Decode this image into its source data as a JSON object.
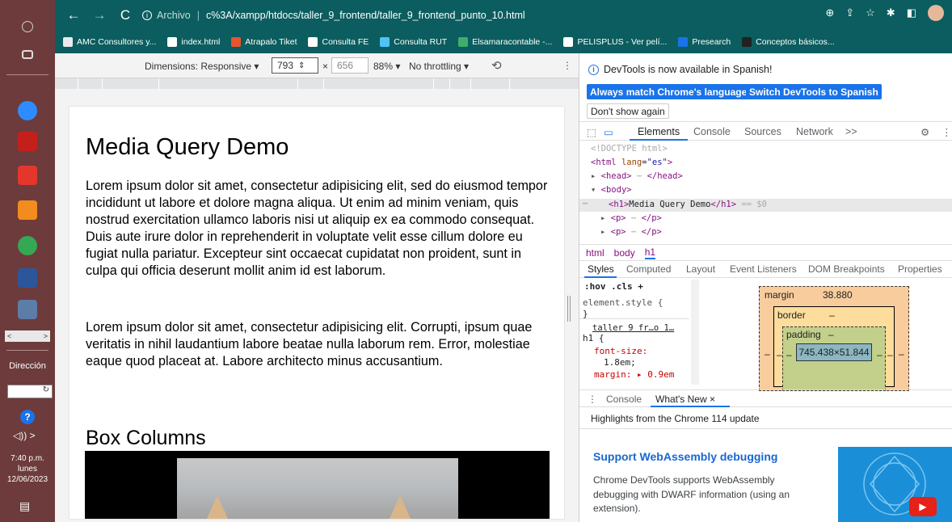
{
  "browser": {
    "url_prefix": "Archivo",
    "url_path": "c%3A/xampp/htdocs/taller_9_frontend/taller_9_frontend_punto_10.html",
    "bookmarks": [
      {
        "label": "AMC Consultores y...",
        "color": "#e8eaed"
      },
      {
        "label": "index.html",
        "color": "#ffffff"
      },
      {
        "label": "Atrapalo Tiket",
        "color": "#e8542e"
      },
      {
        "label": "Consulta FE",
        "color": "#ffffff"
      },
      {
        "label": "Consulta RUT",
        "color": "#4fc3f7"
      },
      {
        "label": "Elsamaracontable -...",
        "color": "#3fae6a"
      },
      {
        "label": "PELISPLUS - Ver pelí...",
        "color": "#ffffff"
      },
      {
        "label": "Presearch",
        "color": "#1a73e8"
      },
      {
        "label": "Conceptos básicos...",
        "color": "#222222"
      }
    ]
  },
  "taskbar": {
    "direccion_label": "Dirección",
    "time": "7:40 p.m.",
    "day": "lunes",
    "date": "12/06/2023",
    "scroll_left": "<",
    "scroll_right": ">",
    "dir_refresh": "↻",
    "vol": "◁)) >"
  },
  "device_toolbar": {
    "dimensions_label": "Dimensions: Responsive ▾",
    "width": "793",
    "x": "×",
    "height": "656",
    "zoom": "88% ▾",
    "throttle": "No throttling ▾"
  },
  "page": {
    "h1": "Media Query Demo",
    "p1": "Lorem ipsum dolor sit amet, consectetur adipisicing elit, sed do eiusmod tempor incididunt ut labore et dolore magna aliqua. Ut enim ad minim veniam, quis nostrud exercitation ullamco laboris nisi ut aliquip ex ea commodo consequat. Duis aute irure dolor in reprehenderit in voluptate velit esse cillum dolore eu fugiat nulla pariatur. Excepteur sint occaecat cupidatat non proident, sunt in culpa qui officia deserunt mollit anim id est laborum.",
    "p2": "Lorem ipsum dolor sit amet, consectetur adipisicing elit. Corrupti, ipsum quae veritatis in nihil laudantium labore beatae nulla laborum rem. Error, molestiae eaque quod placeat at. Labore architecto minus accusantium.",
    "h2": "Box Columns"
  },
  "devtools": {
    "info": "DevTools is now available in Spanish!",
    "btn_match": "Always match Chrome's language",
    "btn_switch": "Switch DevTools to Spanish",
    "btn_dont": "Don't show again",
    "tabs": {
      "elements": "Elements",
      "console": "Console",
      "sources": "Sources",
      "network": "Network",
      "more": ">>"
    },
    "dom": {
      "doctype": "<!DOCTYPE html>",
      "html_open": "<html ",
      "lang_attr": "lang",
      "lang_val": "\"es\"",
      "head": "<head>",
      "head_close": "</head>",
      "body": "<body>",
      "h1_open": "<h1>",
      "h1_text": "Media Query Demo",
      "h1_close": "</h1>",
      "sel_marker": "== $0",
      "p_open": "<p>",
      "p_close": "</p>"
    },
    "crumbs": [
      "html",
      "body",
      "h1"
    ],
    "style_tabs": [
      "Styles",
      "Computed",
      "Layout",
      "Event Listeners",
      "DOM Breakpoints",
      "Properties"
    ],
    "styles": {
      "filter": ":hov .cls +",
      "element_style": "element.style {",
      "close_brace": "}",
      "source": "taller 9 fr…o 1…",
      "selector": "h1 {",
      "font_size_prop": "font-size:",
      "font_size_val": "1.8em;",
      "margin": "margin: ▸ 0.9em"
    },
    "boxmodel": {
      "margin_label": "margin",
      "margin_val": "38.880",
      "border_label": "border",
      "border_val": "–",
      "padding_label": "padding",
      "padding_val": "–",
      "content": "745.438×51.844",
      "dash": "–"
    },
    "drawer_tabs": {
      "console": "Console",
      "whats_new": "What's New ×"
    },
    "highlights": "Highlights from the Chrome 114 update",
    "whats_new_title": "Support WebAssembly debugging",
    "whats_new_body": "Chrome DevTools supports WebAssembly debugging with DWARF information (using an extension)."
  }
}
